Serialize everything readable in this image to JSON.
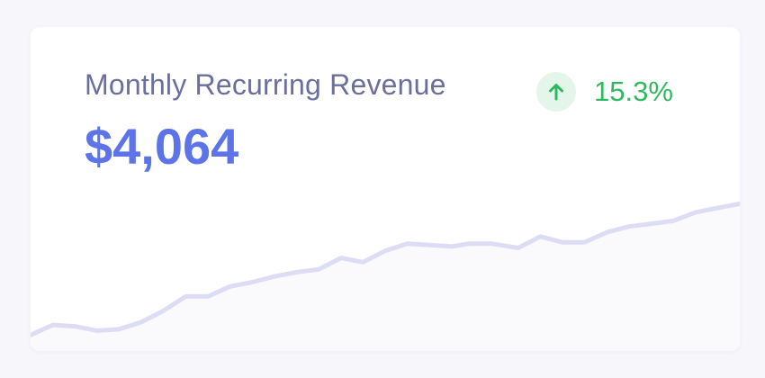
{
  "card": {
    "title": "Monthly Recurring Revenue",
    "value": "$4,064",
    "change": {
      "direction": "up",
      "icon": "arrow-up-icon",
      "text": "15.3%",
      "color": "#2fb95f",
      "badge_color": "#e4f6e9"
    }
  },
  "colors": {
    "value": "#5d74e8",
    "title": "#6b6f9c",
    "line": "#dcdcf5",
    "area": "#fafafd"
  },
  "chart_data": {
    "type": "area",
    "x": [
      0,
      1,
      2,
      3,
      4,
      5,
      6,
      7,
      8,
      9,
      10,
      11,
      12,
      13,
      14,
      15,
      16,
      17,
      18,
      19,
      19.8,
      20.8,
      22,
      23,
      24,
      25,
      26,
      27,
      28,
      29,
      30,
      31,
      32
    ],
    "values": [
      0,
      7,
      6,
      3,
      4,
      9,
      17,
      27,
      27,
      34,
      37,
      41,
      44,
      46,
      54,
      51,
      59,
      64,
      63,
      62,
      64,
      64,
      61,
      69,
      65,
      65,
      72,
      76,
      78,
      80,
      86,
      89,
      92
    ],
    "ylim": [
      -10,
      120
    ]
  }
}
